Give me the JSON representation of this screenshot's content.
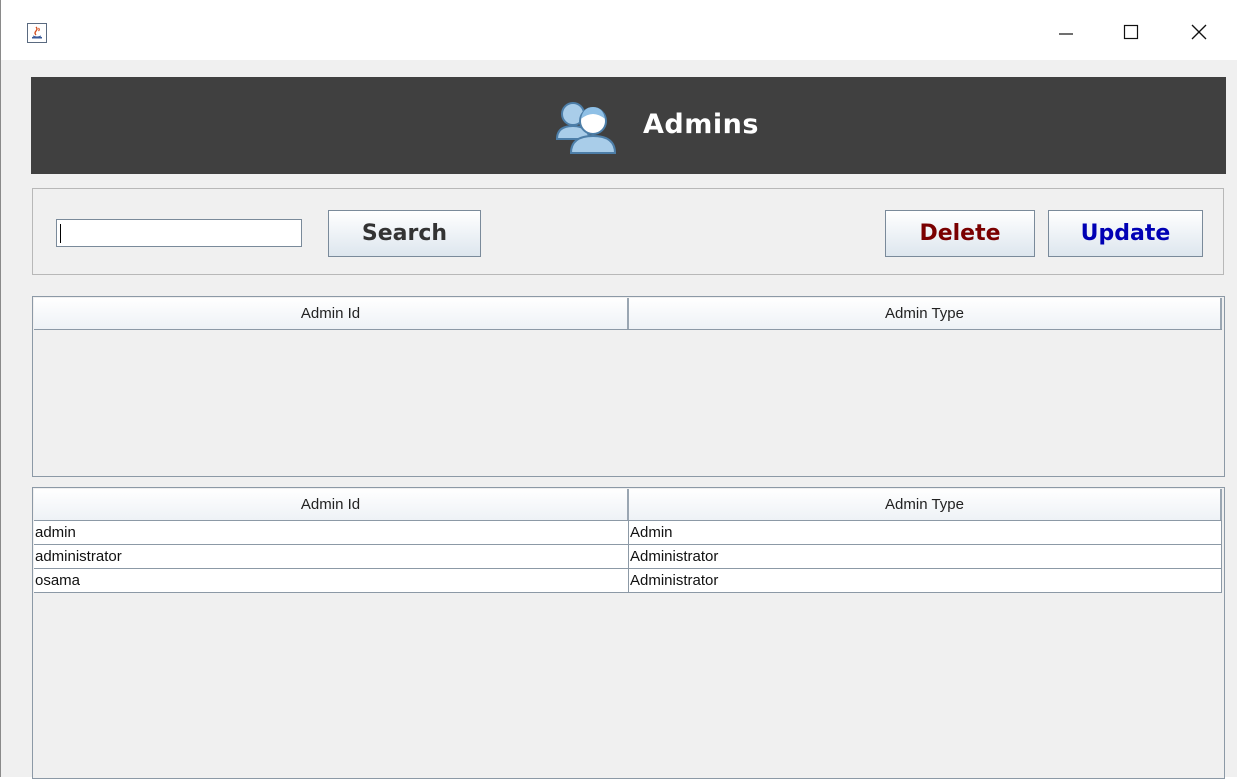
{
  "window": {
    "controls": {
      "minimize_icon": "minimize-icon",
      "maximize_icon": "maximize-icon",
      "close_icon": "close-icon"
    }
  },
  "banner": {
    "title": "Admins",
    "icon": "admins-icon",
    "background": "#404040"
  },
  "toolbar": {
    "search_value": "",
    "search_label": "Search",
    "delete_label": "Delete",
    "update_label": "Update",
    "delete_color": "#7a0000",
    "update_color": "#0000b4"
  },
  "top_table": {
    "columns": [
      "Admin Id",
      "Admin Type"
    ],
    "rows": []
  },
  "bottom_table": {
    "columns": [
      "Admin Id",
      "Admin Type"
    ],
    "rows": [
      [
        "admin",
        "Admin"
      ],
      [
        "administrator",
        "Administrator"
      ],
      [
        "osama",
        "Administrator"
      ]
    ]
  }
}
